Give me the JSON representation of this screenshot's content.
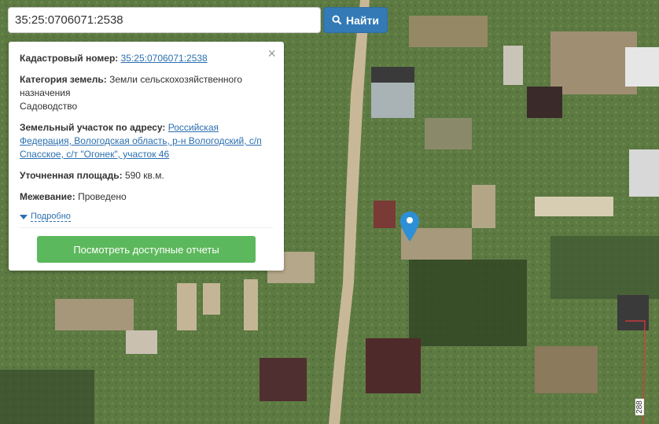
{
  "search": {
    "value": "35:25:0706071:2538",
    "button_label": "Найти",
    "button_icon": "search-icon"
  },
  "popup": {
    "cadastral_label": "Кадастровый номер:",
    "cadastral_value": "35:25:0706071:2538",
    "category_label": "Категория земель:",
    "category_value": "Земли сельскохозяйственного назначения",
    "category_use": "Садоводство",
    "address_label": "Земельный участок по адресу:",
    "address_value": "Российская Федерация, Вологодская область, р-н Вологодский, с/п Спасское, с/т \"Огонек\", участок 46",
    "area_label": "Уточненная площадь:",
    "area_value": "590 кв.м.",
    "survey_label": "Межевание:",
    "survey_value": "Проведено",
    "more_label": "Подробно",
    "reports_button": "Посмотреть доступные отчеты",
    "close_icon": "×"
  },
  "map": {
    "lot_number": "288"
  },
  "colors": {
    "primary": "#337ab7",
    "success": "#5cb85c",
    "link": "#2a6fb0",
    "marker": "#2d8fd5"
  }
}
